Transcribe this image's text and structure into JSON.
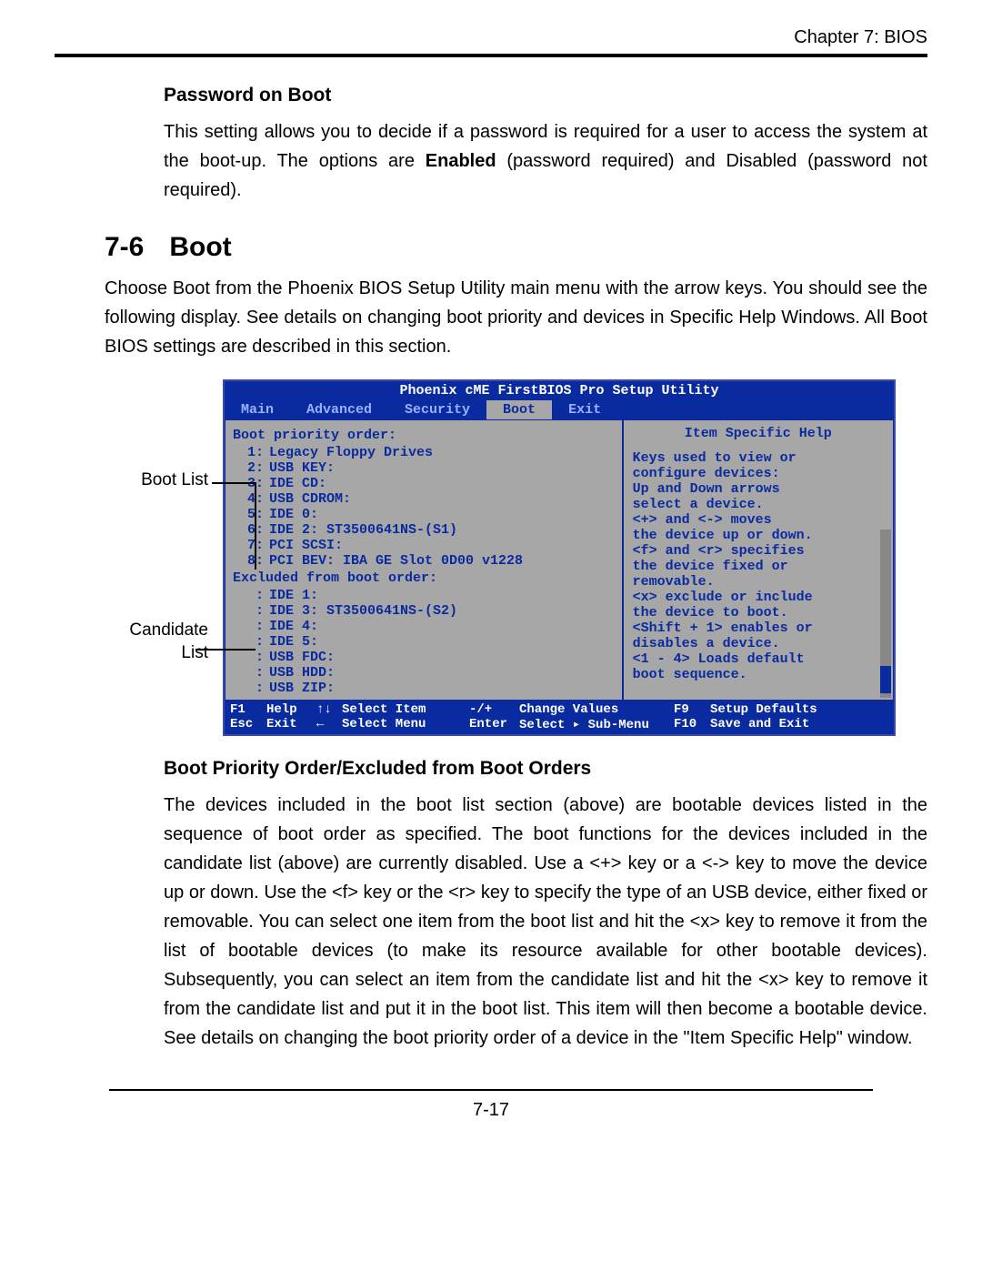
{
  "chapter": "Chapter 7: BIOS",
  "pwd_heading": "Password on Boot",
  "pwd_para_a": "This setting allows you to decide if a password is required for a user to access the system at the boot-up.  The options are ",
  "pwd_para_bold": "Enabled",
  "pwd_para_b": " (password required) and Disabled (password not required).",
  "sec_num": "7-6",
  "sec_name": "Boot",
  "sec_intro": "Choose Boot from the Phoenix BIOS Setup Utility main menu with the arrow keys.  You should see the following display.  See details on changing boot priority and devices in Specific Help Windows.  All Boot BIOS settings are described in this section.",
  "label_bootlist": "Boot List",
  "label_candidate": "Candidate",
  "label_candidate2": "List",
  "bios": {
    "title": "Phoenix cME FirstBIOS Pro Setup Utility",
    "menus": [
      "Main",
      "Advanced",
      "Security",
      "Boot",
      "Exit"
    ],
    "menu_selected": "Boot",
    "left_header": "Boot priority order:",
    "boot_items": [
      {
        "n": "1:",
        "d": "Legacy Floppy Drives"
      },
      {
        "n": "2:",
        "d": "USB KEY:"
      },
      {
        "n": "3:",
        "d": "IDE CD:"
      },
      {
        "n": "4:",
        "d": "USB CDROM:"
      },
      {
        "n": "5:",
        "d": "IDE 0:"
      },
      {
        "n": "6:",
        "d": "IDE 2:   ST3500641NS-(S1)"
      },
      {
        "n": "7:",
        "d": "PCI SCSI:"
      },
      {
        "n": "8:",
        "d": "PCI BEV:  IBA GE Slot 0D00 v1228"
      }
    ],
    "excluded_header": "Excluded from boot order:",
    "excluded_items": [
      {
        "n": ":",
        "d": "IDE 1:"
      },
      {
        "n": ":",
        "d": "IDE 3:   ST3500641NS-(S2)"
      },
      {
        "n": ":",
        "d": "IDE 4:"
      },
      {
        "n": ":",
        "d": "IDE 5:"
      },
      {
        "n": ":",
        "d": "USB FDC:"
      },
      {
        "n": ":",
        "d": "USB HDD:"
      },
      {
        "n": ":",
        "d": "USB ZIP:"
      }
    ],
    "help_title": "Item Specific Help",
    "help_lines": [
      "Keys used to view or",
      "configure devices:",
      "Up and Down arrows",
      "select a device.",
      "<+> and <-> moves",
      "the device up or down.",
      "<f> and <r> specifies",
      "the device fixed or",
      "removable.",
      "<x> exclude or include",
      "the device to boot.",
      "<Shift + 1> enables or",
      "disables a device.",
      "<1 - 4> Loads default",
      "boot sequence."
    ],
    "footer": {
      "f1": "F1",
      "f1l": "Help",
      "arr": "↑↓",
      "arrl": "Select Item",
      "pm": "-/+",
      "pml": "Change Values",
      "f9": "F9",
      "f9l": "Setup Defaults",
      "esc": "Esc",
      "escl": "Exit",
      "lar": "←",
      "larl": "Select Menu",
      "ent": "Enter",
      "entl": "Select ▸ Sub-Menu",
      "f10": "F10",
      "f10l": "Save and Exit"
    }
  },
  "order_heading": "Boot Priority Order/Excluded from Boot Orders",
  "order_para": "The devices included in the boot list section (above) are bootable devices listed in the sequence of boot order as specified. The boot functions for the devices included in the candidate list (above) are currently disabled.  Use a <+> key or a <-> key to move the device up or down. Use the <f> key or the <r> key to specify the type of an USB device, either fixed or removable. You can select one item from the boot list and hit the <x> key to remove it from the list of bootable devices (to make its resource available for other bootable devices). Subsequently, you can select an item from the candidate list and hit the <x> key  to remove it from the candidate list and put it in the boot list. This item will then become a bootable device. See details on changing the boot priority order of a device in the \"Item Specific Help\" window.",
  "page_number": "7-17"
}
